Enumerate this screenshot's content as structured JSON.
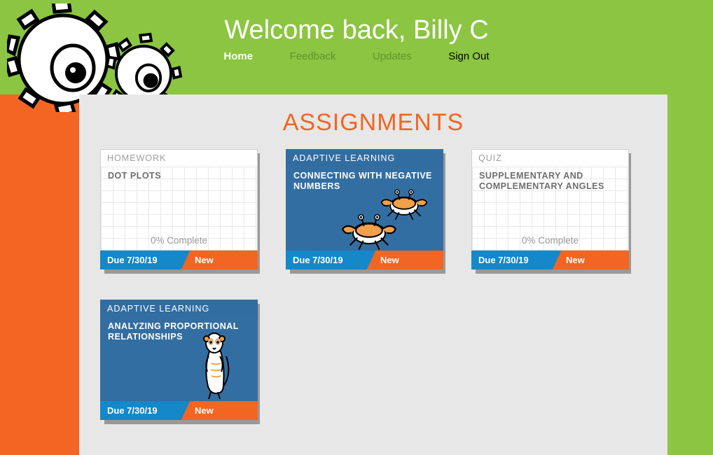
{
  "welcome_text": "Welcome back, Billy C",
  "nav": {
    "home": "Home",
    "feedback": "Feedback",
    "updates": "Updates",
    "signout": "Sign Out"
  },
  "section_title": "ASSIGNMENTS",
  "labels": {
    "new": "New"
  },
  "cards": [
    {
      "style": "white",
      "category": "HOMEWORK",
      "title": "DOT PLOTS",
      "complete": "0% Complete",
      "due": "Due 7/30/19",
      "status": "New"
    },
    {
      "style": "blue",
      "category": "ADAPTIVE LEARNING",
      "title": "CONNECTING WITH NEGATIVE NUMBERS",
      "complete": "",
      "due": "Due 7/30/19",
      "status": "New",
      "illustration": "crabs"
    },
    {
      "style": "white",
      "category": "QUIZ",
      "title": "SUPPLEMENTARY AND COMPLEMENTARY ANGLES",
      "complete": "0% Complete",
      "due": "Due 7/30/19",
      "status": "New"
    },
    {
      "style": "blue",
      "category": "ADAPTIVE LEARNING",
      "title": "ANALYZING PROPORTIONAL RELATIONSHIPS",
      "complete": "",
      "due": "Due 7/30/19",
      "status": "New",
      "illustration": "meerkat"
    }
  ]
}
